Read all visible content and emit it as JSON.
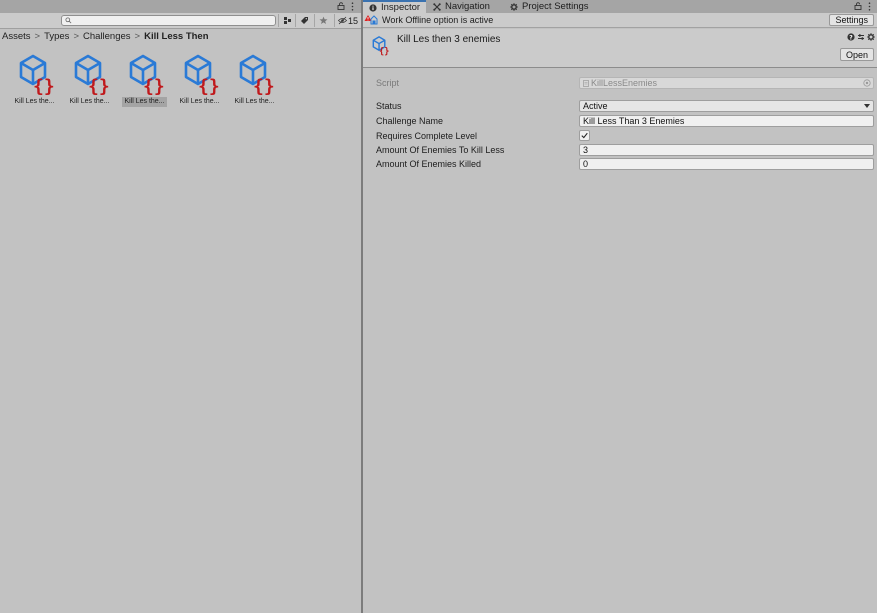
{
  "project": {
    "search": {
      "placeholder": "",
      "value": ""
    },
    "hidden_count": "15",
    "breadcrumb": [
      "Assets",
      "Types",
      "Challenges",
      "Kill Less Then"
    ],
    "assets": [
      {
        "label": "Kill Les the...",
        "selected": false
      },
      {
        "label": "Kill Les the...",
        "selected": false
      },
      {
        "label": "Kill Les the...",
        "selected": true
      },
      {
        "label": "Kill Les the...",
        "selected": false
      },
      {
        "label": "Kill Les the...",
        "selected": false
      }
    ]
  },
  "inspector": {
    "tabs": [
      {
        "label": "Inspector",
        "icon": "info-icon",
        "active": true
      },
      {
        "label": "Navigation",
        "icon": "navigation-icon",
        "active": false
      },
      {
        "label": "Project Settings",
        "icon": "gear-icon",
        "active": false
      }
    ],
    "offline_message": "Work Offline option is active",
    "settings_label": "Settings",
    "object_title": "Kill Les then 3 enemies",
    "open_label": "Open",
    "script": {
      "label": "Script",
      "value": "KillLessEnemies"
    },
    "properties": {
      "status": {
        "label": "Status",
        "value": "Active"
      },
      "challenge_name": {
        "label": "Challenge Name",
        "value": "Kill Less Than 3 Enemies"
      },
      "requires_complete_level": {
        "label": "Requires Complete Level",
        "checked": true
      },
      "amount_to_kill_less": {
        "label": "Amount Of Enemies To Kill Less",
        "value": "3"
      },
      "amount_killed": {
        "label": "Amount Of Enemies Killed",
        "value": "0"
      }
    }
  },
  "colors": {
    "panel_bg": "#c2c2c2",
    "tab_accent": "#3a72b0",
    "asset_cube": "#2a7ad6",
    "asset_braces": "#c0191c"
  }
}
